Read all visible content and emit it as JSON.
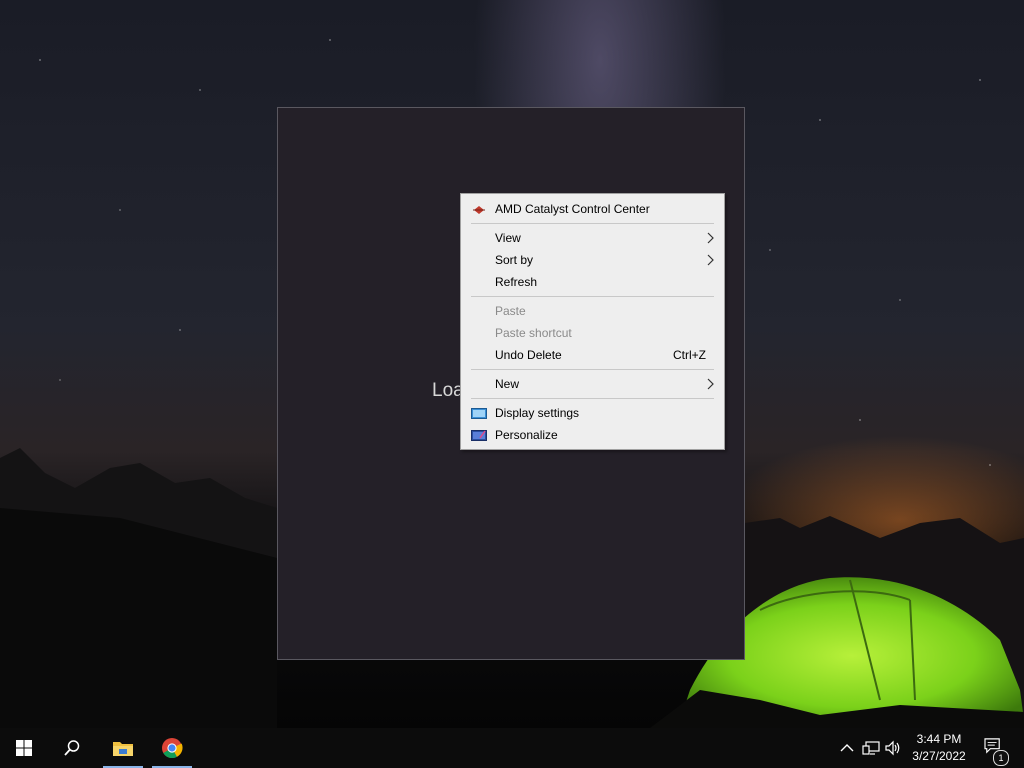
{
  "desktop": {
    "loading_text": "Loa"
  },
  "context_menu": {
    "items": [
      {
        "label": "AMD Catalyst Control Center",
        "icon": "amd-icon"
      },
      {
        "label": "View",
        "submenu": true
      },
      {
        "label": "Sort by",
        "submenu": true
      },
      {
        "label": "Refresh"
      },
      {
        "label": "Paste",
        "disabled": true
      },
      {
        "label": "Paste shortcut",
        "disabled": true
      },
      {
        "label": "Undo Delete",
        "shortcut": "Ctrl+Z"
      },
      {
        "label": "New",
        "submenu": true
      },
      {
        "label": "Display settings",
        "icon": "display-settings-icon"
      },
      {
        "label": "Personalize",
        "icon": "personalize-icon"
      }
    ]
  },
  "taskbar": {
    "pinned": [
      {
        "name": "start-button",
        "icon": "windows-logo-icon"
      },
      {
        "name": "search-button",
        "icon": "search-icon"
      },
      {
        "name": "file-explorer",
        "icon": "folder-icon",
        "active": true
      },
      {
        "name": "chrome",
        "icon": "chrome-icon",
        "active": true
      }
    ],
    "tray": {
      "time": "3:44 PM",
      "date": "3/27/2022",
      "notification_count": "1"
    }
  },
  "colors": {
    "taskbar_bg": "#0c0c0c",
    "menu_bg": "#eeeeee",
    "active_underline": "#8ab4e8",
    "window_bg": "#242028"
  }
}
